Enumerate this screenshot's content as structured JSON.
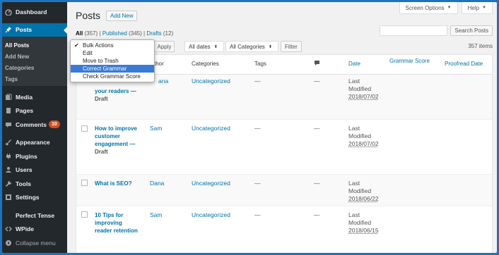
{
  "sidebar": {
    "dashboard": "Dashboard",
    "posts": "Posts",
    "sub": [
      "All Posts",
      "Add New",
      "Categories",
      "Tags"
    ],
    "media": "Media",
    "pages": "Pages",
    "comments": "Comments",
    "comments_badge": "10",
    "appearance": "Appearance",
    "plugins": "Plugins",
    "users": "Users",
    "tools": "Tools",
    "settings": "Settings",
    "perfect_tense": "Perfect Tense",
    "wpide": "WPide",
    "collapse": "Collapse menu"
  },
  "header": {
    "title": "Posts",
    "add_new": "Add New",
    "screen_options": "Screen Options",
    "help": "Help",
    "search_button": "Search Posts"
  },
  "filters": {
    "all": "All",
    "all_count": "(357)",
    "published": "Published",
    "published_count": "(345)",
    "drafts": "Drafts",
    "drafts_count": "(12)",
    "sep": "|"
  },
  "tablenav": {
    "apply": "Apply",
    "dates": "All dates",
    "categories": "All Categories",
    "filter": "Filter",
    "items": "357 items"
  },
  "bulk_menu": [
    "Bulk Actions",
    "Edit",
    "Move to Trash",
    "Correct Grammar",
    "Check Grammar Score"
  ],
  "columns": {
    "author": "thor",
    "categories": "Categories",
    "tags": "Tags",
    "date": "Date",
    "grammar_score": "Grammar Score",
    "proofread_date": "Proofread Date"
  },
  "rows": [
    {
      "title1": "your readers —",
      "title2": "Draft",
      "author": "ana",
      "category": "Uncategorized",
      "tags": "—",
      "comments": "—",
      "date_label1": "Last",
      "date_label2": "Modified",
      "date": "2018/07/02"
    },
    {
      "title1": "How to improve",
      "title2": "customer",
      "title3": "engagement —",
      "title4": "Draft",
      "author": "Sam",
      "category": "Uncategorized",
      "tags": "—",
      "comments": "—",
      "date_label1": "Last",
      "date_label2": "Modified",
      "date": "2018/07/02"
    },
    {
      "title1": "What is SEO?",
      "author": "Dana",
      "category": "Uncategorized",
      "tags": "—",
      "comments": "—",
      "date_label1": "Last",
      "date_label2": "Modified",
      "date": "2018/06/22"
    },
    {
      "title1": "10 Tips for",
      "title2": "improving",
      "title3": "reader retention",
      "author": "Sam",
      "category": "Uncategorized",
      "tags": "—",
      "comments": "—",
      "date_label1": "Last",
      "date_label2": "Modified",
      "date": "2018/06/15"
    }
  ]
}
